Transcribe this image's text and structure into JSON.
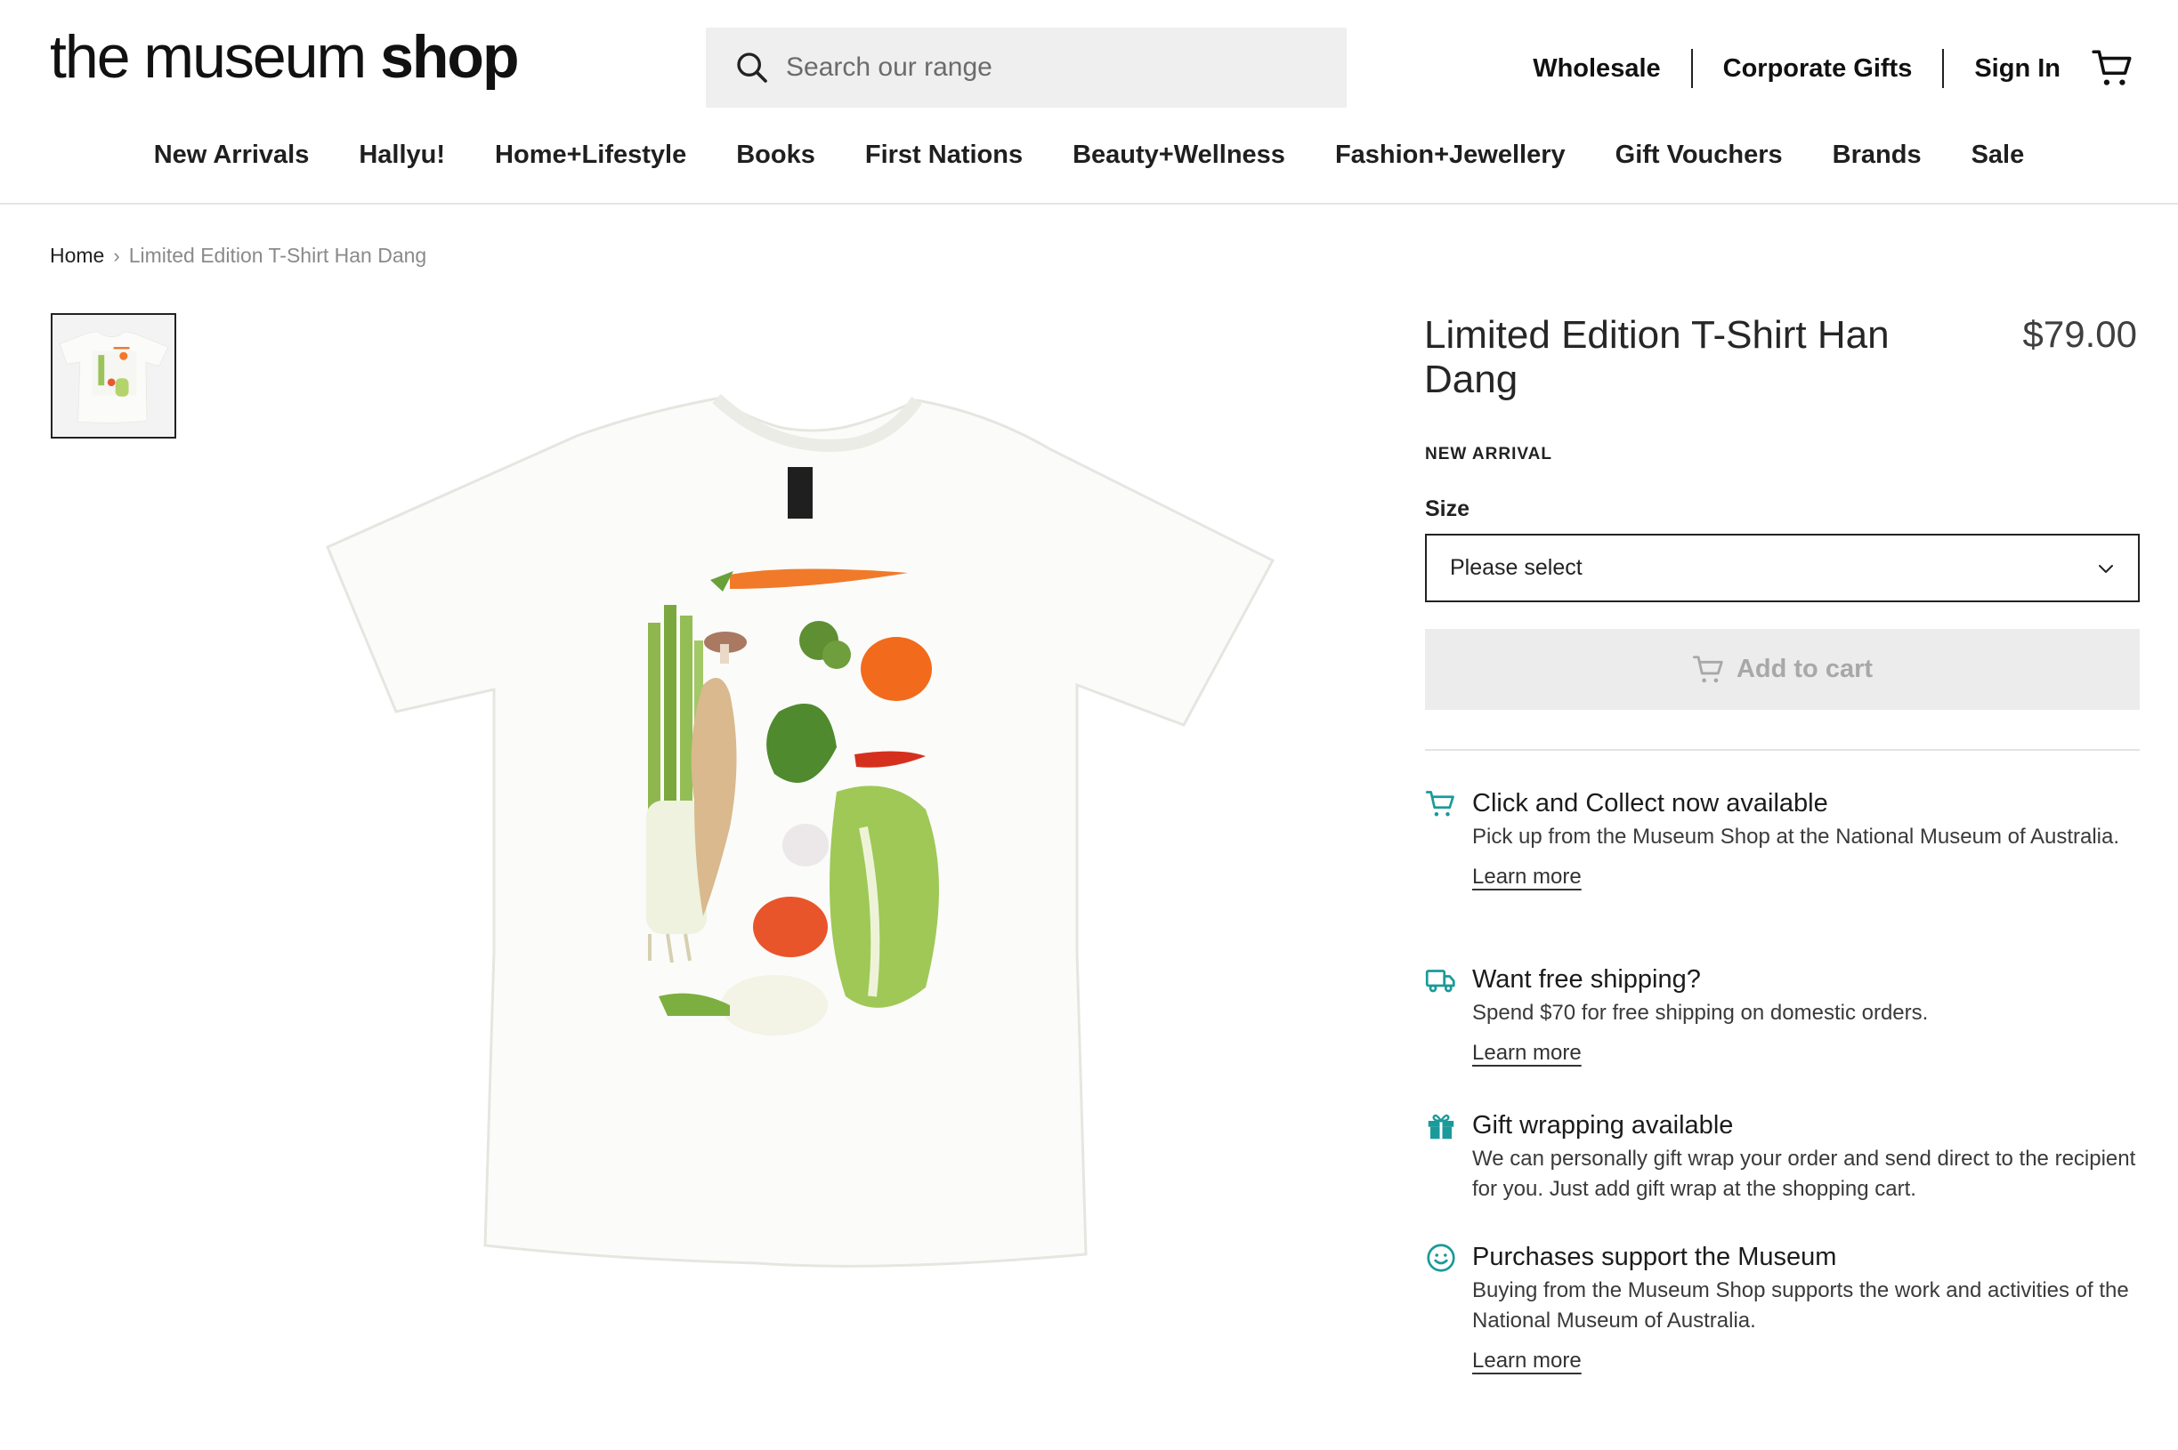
{
  "header": {
    "logo_light": "the museum ",
    "logo_bold": "shop",
    "search_placeholder": "Search our range",
    "util_links": [
      "Wholesale",
      "Corporate Gifts",
      "Sign In"
    ]
  },
  "nav": [
    "New Arrivals",
    "Hallyu!",
    "Home+Lifestyle",
    "Books",
    "First Nations",
    "Beauty+Wellness",
    "Fashion+Jewellery",
    "Gift Vouchers",
    "Brands",
    "Sale"
  ],
  "breadcrumb": {
    "home": "Home",
    "current": "Limited Edition T-Shirt Han Dang"
  },
  "product": {
    "title": "Limited Edition T-Shirt Han Dang",
    "price": "$79.00",
    "badge": "NEW ARRIVAL",
    "size_label": "Size",
    "size_value": "Please select",
    "add_to_cart": "Add to cart"
  },
  "features": [
    {
      "icon": "cart-icon",
      "heading": "Click and Collect now available",
      "text": "Pick up from the Museum Shop at the National Museum of Australia.",
      "link": "Learn more"
    },
    {
      "icon": "truck-icon",
      "heading": "Want free shipping?",
      "text": "Spend $70 for free shipping on domestic orders.",
      "link": "Learn more"
    },
    {
      "icon": "gift-icon",
      "heading": "Gift wrapping available",
      "text": "We can personally gift wrap your order and send direct to the recipient for you. Just add gift wrap at the shopping cart.",
      "link": ""
    },
    {
      "icon": "smiley-icon",
      "heading": "Purchases support the Museum",
      "text": "Buying from the Museum Shop supports the work and activities of the National Museum of Australia.",
      "link": "Learn more"
    }
  ],
  "colors": {
    "accent": "#1a9a9a",
    "text": "#1a1a1a",
    "disabled_button": "#ececec"
  }
}
